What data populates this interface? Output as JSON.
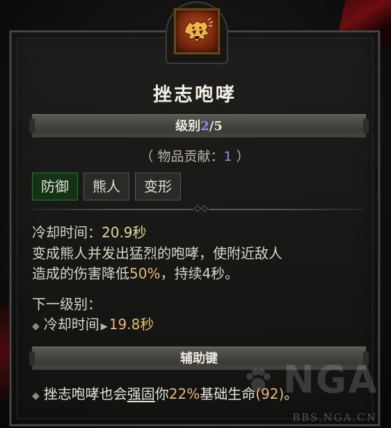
{
  "skill": {
    "title": "挫志咆哮",
    "icon": "bear-roar-icon",
    "level_label": "级别",
    "level_current": "2",
    "level_max": "/5",
    "contrib_prefix": "（ 物品贡献：",
    "contrib_value": "1",
    "contrib_suffix": " ）",
    "tags": [
      "防御",
      "熊人",
      "变形"
    ],
    "cooldown_label": "冷却时间：",
    "cooldown_value": "20.9秒",
    "desc_line1": "变成熊人并发出猛烈的咆哮，使附近敌人",
    "desc_line2_a": "造成的伤害降低",
    "desc_line2_pct": "50%",
    "desc_line2_b": "，持续4秒。",
    "next_level_label": "下一级别：",
    "next_cd_label": "冷却时间",
    "next_cd_value": "19.8秒"
  },
  "modifier": {
    "header": "辅助键",
    "text_a": "挫志咆哮也会",
    "text_link": "强固",
    "text_b": "你",
    "text_pct": "22%",
    "text_c": "基础生命",
    "text_d": "(92)",
    "text_e": "。"
  },
  "watermark": {
    "logo": "NGA",
    "url": "BBS.NGA.CN"
  },
  "colors": {
    "rank_accent": "#8a8fe0",
    "value_accent": "#e8b97a",
    "tag_primary_border": "#2f7a33"
  }
}
